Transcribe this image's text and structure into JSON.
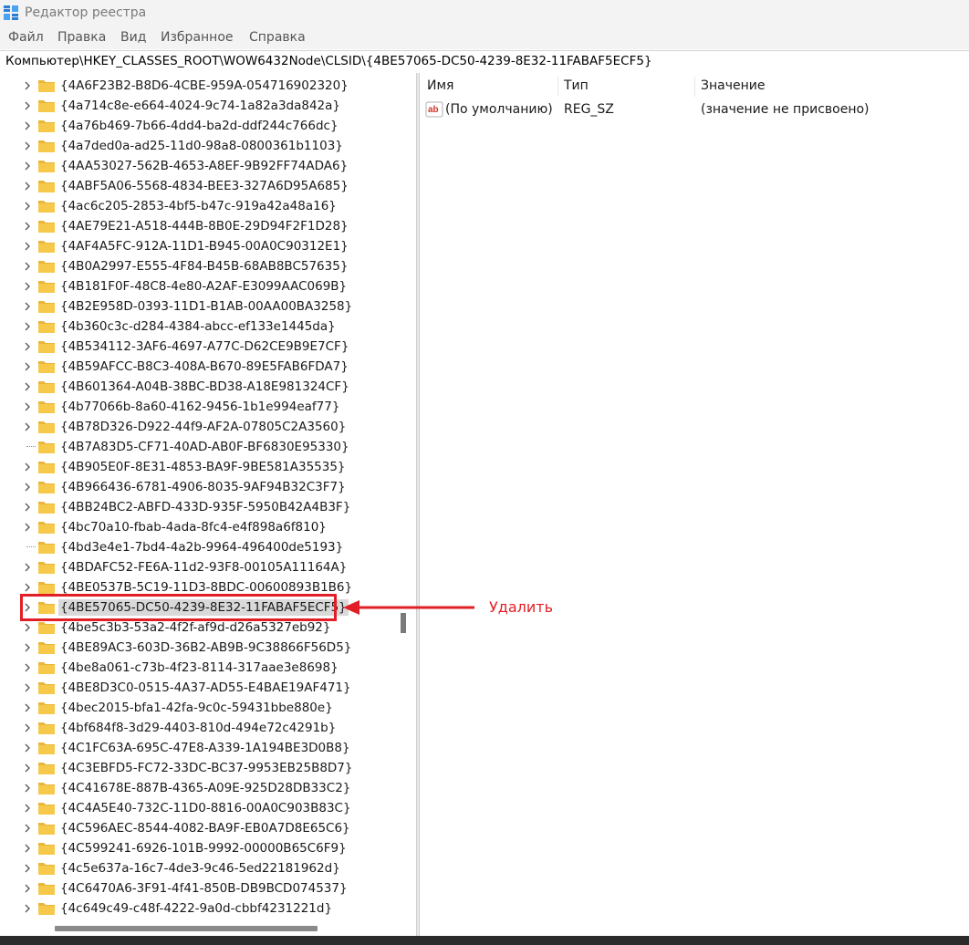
{
  "window": {
    "title": "Редактор реестра"
  },
  "menu": [
    "Файл",
    "Правка",
    "Вид",
    "Избранное",
    "Справка"
  ],
  "address": "Компьютер\\HKEY_CLASSES_ROOT\\WOW6432Node\\CLSID\\{4BE57065-DC50-4239-8E32-11FABAF5ECF5}",
  "tree": {
    "keys": [
      {
        "label": "{4A6F23B2-B8D6-4CBE-959A-054716902320}",
        "expandable": true
      },
      {
        "label": "{4a714c8e-e664-4024-9c74-1a82a3da842a}",
        "expandable": true
      },
      {
        "label": "{4a76b469-7b66-4dd4-ba2d-ddf244c766dc}",
        "expandable": true
      },
      {
        "label": "{4a7ded0a-ad25-11d0-98a8-0800361b1103}",
        "expandable": true
      },
      {
        "label": "{4AA53027-562B-4653-A8EF-9B92FF74ADA6}",
        "expandable": true
      },
      {
        "label": "{4ABF5A06-5568-4834-BEE3-327A6D95A685}",
        "expandable": true
      },
      {
        "label": "{4ac6c205-2853-4bf5-b47c-919a42a48a16}",
        "expandable": true
      },
      {
        "label": "{4AE79E21-A518-444B-8B0E-29D94F2F1D28}",
        "expandable": true
      },
      {
        "label": "{4AF4A5FC-912A-11D1-B945-00A0C90312E1}",
        "expandable": true
      },
      {
        "label": "{4B0A2997-E555-4F84-B45B-68AB8BC57635}",
        "expandable": true
      },
      {
        "label": "{4B181F0F-48C8-4e80-A2AF-E3099AAC069B}",
        "expandable": true
      },
      {
        "label": "{4B2E958D-0393-11D1-B1AB-00AA00BA3258}",
        "expandable": true
      },
      {
        "label": "{4b360c3c-d284-4384-abcc-ef133e1445da}",
        "expandable": true
      },
      {
        "label": "{4B534112-3AF6-4697-A77C-D62CE9B9E7CF}",
        "expandable": true
      },
      {
        "label": "{4B59AFCC-B8C3-408A-B670-89E5FAB6FDA7}",
        "expandable": true
      },
      {
        "label": "{4B601364-A04B-38BC-BD38-A18E981324CF}",
        "expandable": true
      },
      {
        "label": "{4b77066b-8a60-4162-9456-1b1e994eaf77}",
        "expandable": true
      },
      {
        "label": "{4B78D326-D922-44f9-AF2A-07805C2A3560}",
        "expandable": true
      },
      {
        "label": "{4B7A83D5-CF71-40AD-AB0F-BF6830E95330}",
        "expandable": false
      },
      {
        "label": "{4B905E0F-8E31-4853-BA9F-9BE581A35535}",
        "expandable": true
      },
      {
        "label": "{4B966436-6781-4906-8035-9AF94B32C3F7}",
        "expandable": true
      },
      {
        "label": "{4BB24BC2-ABFD-433D-935F-5950B42A4B3F}",
        "expandable": true
      },
      {
        "label": "{4bc70a10-fbab-4ada-8fc4-e4f898a6f810}",
        "expandable": true
      },
      {
        "label": "{4bd3e4e1-7bd4-4a2b-9964-496400de5193}",
        "expandable": false
      },
      {
        "label": "{4BDAFC52-FE6A-11d2-93F8-00105A11164A}",
        "expandable": true
      },
      {
        "label": "{4BE0537B-5C19-11D3-8BDC-00600893B1B6}",
        "expandable": true
      },
      {
        "label": "{4BE57065-DC50-4239-8E32-11FABAF5ECF5}",
        "expandable": true,
        "selected": true
      },
      {
        "label": "{4be5c3b3-53a2-4f2f-af9d-d26a5327eb92}",
        "expandable": true
      },
      {
        "label": "{4BE89AC3-603D-36B2-AB9B-9C38866F56D5}",
        "expandable": true
      },
      {
        "label": "{4be8a061-c73b-4f23-8114-317aae3e8698}",
        "expandable": true
      },
      {
        "label": "{4BE8D3C0-0515-4A37-AD55-E4BAE19AF471}",
        "expandable": true
      },
      {
        "label": "{4bec2015-bfa1-42fa-9c0c-59431bbe880e}",
        "expandable": true
      },
      {
        "label": "{4bf684f8-3d29-4403-810d-494e72c4291b}",
        "expandable": true
      },
      {
        "label": "{4C1FC63A-695C-47E8-A339-1A194BE3D0B8}",
        "expandable": true
      },
      {
        "label": "{4C3EBFD5-FC72-33DC-BC37-9953EB25B8D7}",
        "expandable": true
      },
      {
        "label": "{4C41678E-887B-4365-A09E-925D28DB33C2}",
        "expandable": true
      },
      {
        "label": "{4C4A5E40-732C-11D0-8816-00A0C903B83C}",
        "expandable": true
      },
      {
        "label": "{4C596AEC-8544-4082-BA9F-EB0A7D8E65C6}",
        "expandable": true
      },
      {
        "label": "{4C599241-6926-101B-9992-00000B65C6F9}",
        "expandable": true
      },
      {
        "label": "{4c5e637a-16c7-4de3-9c46-5ed22181962d}",
        "expandable": true
      },
      {
        "label": "{4C6470A6-3F91-4f41-850B-DB9BCD074537}",
        "expandable": true
      },
      {
        "label": "{4c649c49-c48f-4222-9a0d-cbbf4231221d}",
        "expandable": true
      }
    ]
  },
  "list": {
    "columns": [
      "Имя",
      "Тип",
      "Значение"
    ],
    "rows": [
      {
        "name": "(По умолчанию)",
        "type": "REG_SZ",
        "value": "(значение не присвоено)",
        "icon": "string-value-icon"
      }
    ]
  },
  "annotation": {
    "text": "Удалить",
    "color": "#e21f26"
  },
  "colors": {
    "accent": "#e21f26",
    "folder": "#f6c94a",
    "selection": "#d9d9d9"
  }
}
